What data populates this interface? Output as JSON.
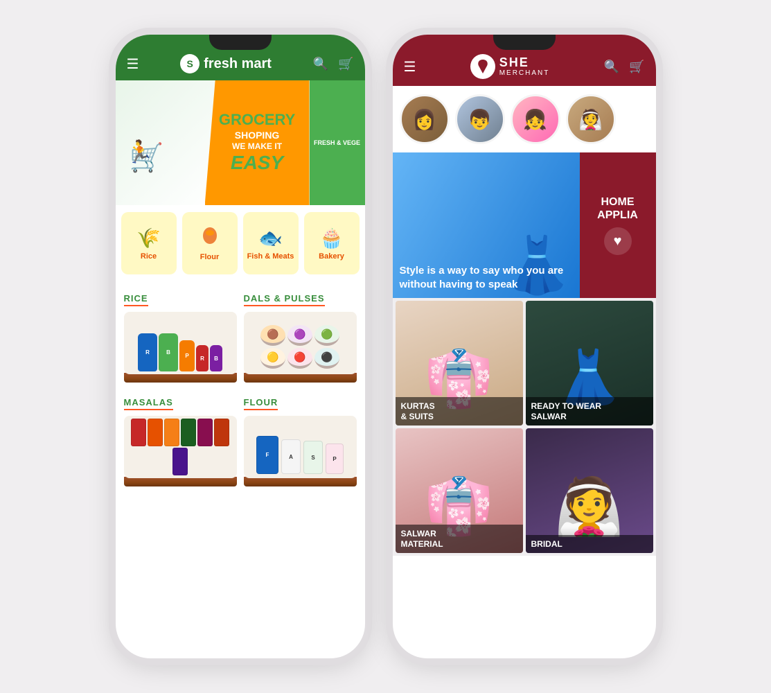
{
  "freshmart": {
    "header": {
      "logo_text": "fresh mart",
      "menu_icon": "☰",
      "search_icon": "🔍",
      "cart_icon": "🛒"
    },
    "banner": {
      "text_line1": "GROCERY",
      "text_line2": "SHOPING",
      "text_line3": "WE MAKE IT",
      "text_line4": "EASY",
      "side_text": "FRESH & VEGE"
    },
    "categories": [
      {
        "label": "Rice",
        "icon": "🌾"
      },
      {
        "label": "Flour",
        "icon": "🌾"
      },
      {
        "label": "Fish & Meats",
        "icon": "🐟"
      },
      {
        "label": "Bakery",
        "icon": "🧁"
      }
    ],
    "sections": [
      {
        "title": "RICE",
        "type": "rice"
      },
      {
        "title": "DALS & PULSES",
        "type": "dals"
      },
      {
        "title": "MASALAS",
        "type": "masalas"
      },
      {
        "title": "FLOUR",
        "type": "flour"
      }
    ]
  },
  "shemerchant": {
    "header": {
      "logo_text": "SHE",
      "logo_sub": "MERCHANT",
      "menu_icon": "☰",
      "search_icon": "🔍",
      "cart_icon": "🛒"
    },
    "banner": {
      "style_quote": "Style is a way to say who you are without having to speak",
      "side_text": "HOME APPLIA"
    },
    "categories": [
      {
        "label": "KURTAS & SUITS"
      },
      {
        "label": "READY TO WEAR SALWAR"
      },
      {
        "label": "SALWAR MATERIAL"
      },
      {
        "label": "BRIDAL"
      }
    ]
  }
}
